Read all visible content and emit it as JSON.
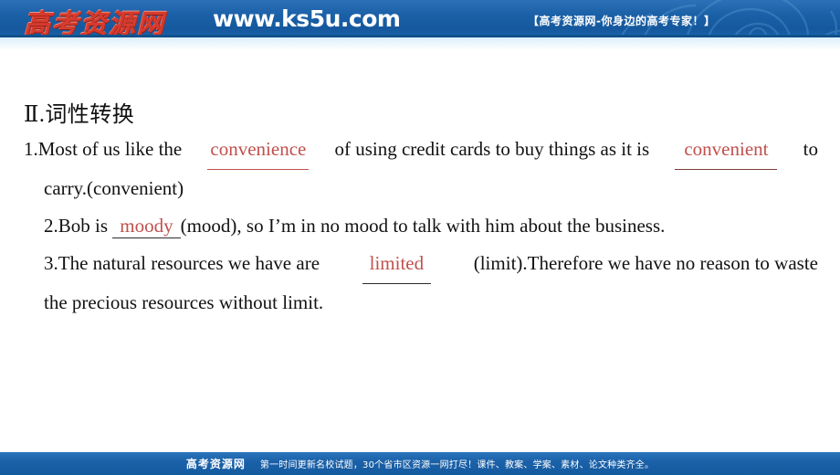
{
  "header": {
    "logo_cn": "高考资源网",
    "logo_url": "www.ks5u.com",
    "tagline": "【高考资源网-你身边的高考专家！】",
    "bar_color": "#1b61a8",
    "logo_color": "#d63b2f"
  },
  "main": {
    "section_title": "Ⅱ.词性转换",
    "answer_color": "#c0504d",
    "items": [
      {
        "number": "1.",
        "line1_before": "1.Most of us like the ",
        "answer1": "convenience",
        "line1_mid": " of using credit cards to buy things as it is ",
        "answer2": "convenient",
        "line1_after": " to",
        "line2": "carry.(convenient)"
      },
      {
        "number": "2.",
        "line1_before": "2.Bob is ",
        "answer1": "moody",
        "line1_after": "(mood), so I’m in no mood to talk with him about the business."
      },
      {
        "number": "3.",
        "line1_before": "3.The natural resources we have are ",
        "answer1": "limited",
        "line1_after": "(limit).Therefore we have no reason to waste",
        "line2": "the precious resources without limit."
      }
    ]
  },
  "footer": {
    "logo": "高考资源网",
    "text": "第一时间更新名校试题，30个省市区资源一网打尽！课件、教案、学案、素材、论文种类齐全。",
    "bar_color": "#1b61a9"
  }
}
